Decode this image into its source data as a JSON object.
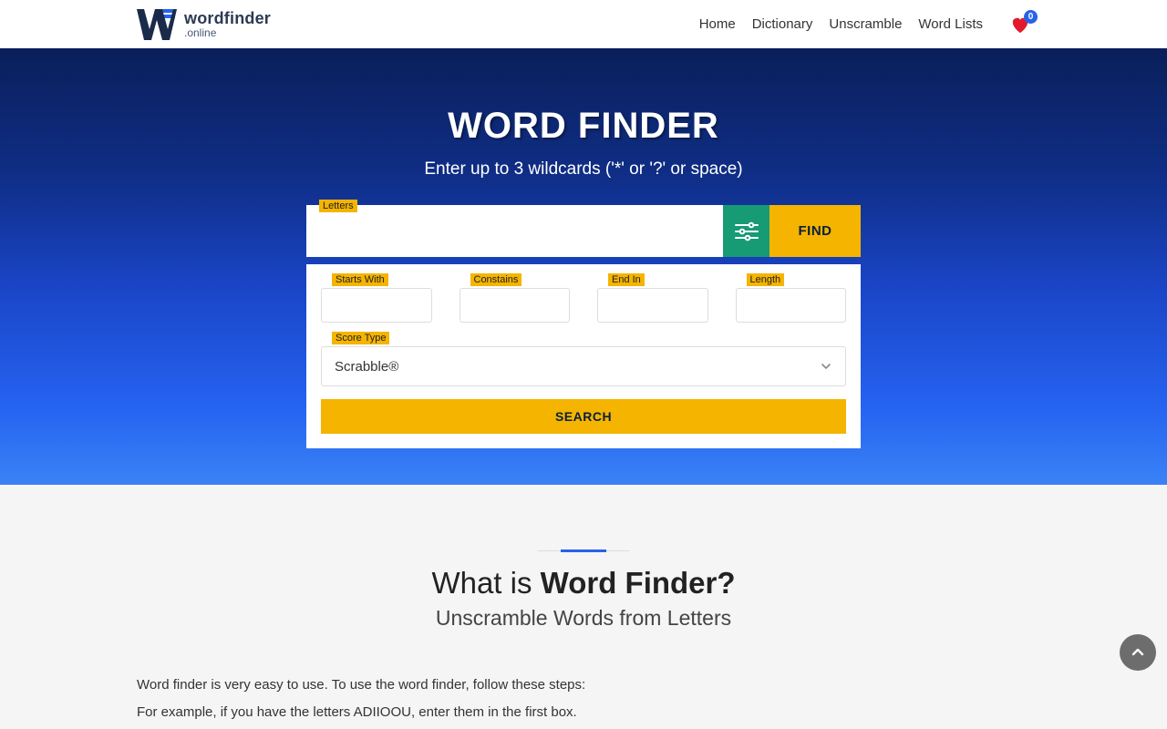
{
  "header": {
    "logo_main": "wordfinder",
    "logo_sub": ".online",
    "nav": [
      "Home",
      "Dictionary",
      "Unscramble",
      "Word Lists"
    ],
    "favorites_count": "0"
  },
  "hero": {
    "title": "WORD FINDER",
    "subtitle": "Enter up to 3 wildcards ('*' or '?' or space)",
    "letters_label": "Letters",
    "find_label": "FIND"
  },
  "adv": {
    "starts_with_label": "Starts With",
    "contains_label": "Constains",
    "end_in_label": "End In",
    "length_label": "Length",
    "score_type_label": "Score Type",
    "score_type_value": "Scrabble®",
    "search_label": "SEARCH"
  },
  "info": {
    "heading_prefix": "What is ",
    "heading_bold": "Word Finder?",
    "subheading": "Unscramble Words from Letters",
    "paragraphs": [
      "Word finder is very easy to use. To use the word finder, follow these steps:",
      "For example, if you have the letters ADIIOOU, enter them in the first box."
    ]
  }
}
